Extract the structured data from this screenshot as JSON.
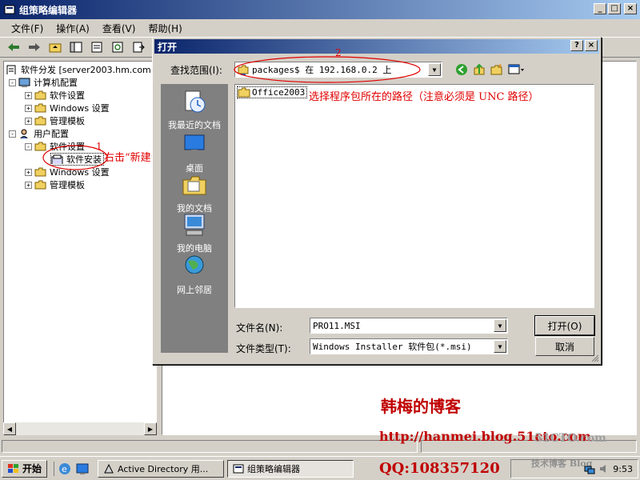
{
  "app": {
    "title": "组策略编辑器",
    "menu": [
      "文件(F)",
      "操作(A)",
      "查看(V)",
      "帮助(H)"
    ]
  },
  "tree": {
    "root": "软件分发 [server2003.hm.com",
    "items": [
      {
        "label": "计算机配置"
      },
      {
        "label": "软件设置"
      },
      {
        "label": "Windows 设置"
      },
      {
        "label": "管理模板"
      },
      {
        "label": "用户配置"
      },
      {
        "label": "软件设置"
      },
      {
        "label": "软件安装"
      },
      {
        "label": "Windows 设置"
      },
      {
        "label": "管理模板"
      }
    ]
  },
  "dialog": {
    "title": "打开",
    "lookin_label": "查找范围(I):",
    "lookin_value": "packages$ 在 192.168.0.2 上",
    "places": [
      "我最近的文档",
      "桌面",
      "我的文档",
      "我的电脑",
      "网上邻居"
    ],
    "files": [
      "Office2003"
    ],
    "filename_label": "文件名(N):",
    "filename_value": "PRO11.MSI",
    "filetype_label": "文件类型(T):",
    "filetype_value": "Windows Installer 软件包(*.msi)",
    "open_button": "打开(O)",
    "cancel_button": "取消",
    "help_button": "?",
    "close_button": "×"
  },
  "annotations": {
    "num1": "1",
    "num2": "2",
    "note1": "右击“新建”程序包",
    "note2": "选择程序包所在的路径（注意必须是 UNC 路径）"
  },
  "watermark": {
    "blog": "韩梅的博客",
    "url": "http://hanmei.blog.51cto.com",
    "qq": "QQ:108357120",
    "site": "51CTO.com",
    "site2": "技术博客 Blog"
  },
  "taskbar": {
    "start": "开始",
    "tasks": [
      "Active Directory 用...",
      "组策略编辑器"
    ],
    "clock": "9:53"
  }
}
